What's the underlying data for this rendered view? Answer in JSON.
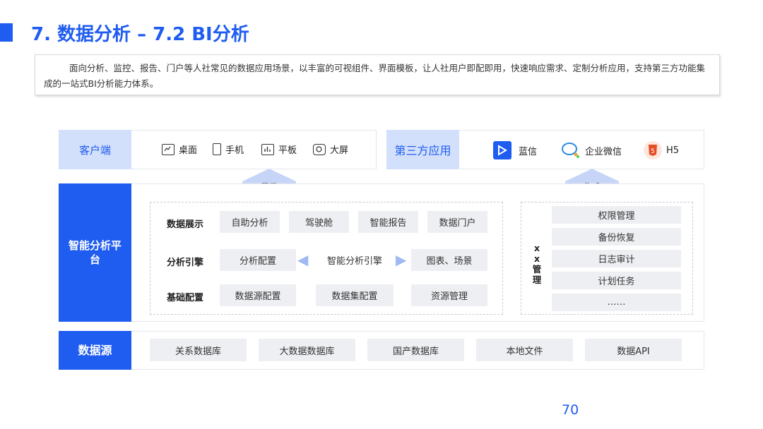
{
  "header": {
    "title": "7. 数据分析 – 7.2 BI分析"
  },
  "description": "面向分析、监控、报告、门户等人社常见的数据应用场景，以丰富的可视组件、界面模板，让人社用户即配即用，快速响应需求、定制分析应用，支持第三方功能集成的一站式BI分析能力体系。",
  "client": {
    "label": "客户端",
    "items": [
      {
        "label": "桌面",
        "icon": "desktop-icon"
      },
      {
        "label": "手机",
        "icon": "mobile-icon"
      },
      {
        "label": "平板",
        "icon": "tablet-icon"
      },
      {
        "label": "大屏",
        "icon": "large-screen-icon"
      }
    ]
  },
  "third_party": {
    "label": "第三方应用",
    "items": [
      {
        "label": "蓝信",
        "icon": "lanxin-icon"
      },
      {
        "label": "企业微信",
        "icon": "wecom-icon"
      },
      {
        "label": "H5",
        "icon": "html5-icon"
      }
    ]
  },
  "arrows": {
    "display": "展示",
    "integrate": "集成"
  },
  "platform": {
    "label": "智能分析平台",
    "rows": [
      {
        "label": "数据展示",
        "cells": [
          "自助分析",
          "驾驶舱",
          "智能报告",
          "数据门户"
        ]
      },
      {
        "label": "分析引擎",
        "cells": [
          "分析配置",
          "智能分析引擎",
          "图表、场景"
        ]
      },
      {
        "label": "基础配置",
        "cells": [
          "数据源配置",
          "数据集配置",
          "资源管理"
        ]
      }
    ],
    "management": {
      "label": "xx管理",
      "items": [
        "权限管理",
        "备份恢复",
        "日志审计",
        "计划任务",
        "……"
      ]
    }
  },
  "datasource": {
    "label": "数据源",
    "items": [
      "关系数据库",
      "大数据数据库",
      "国产数据库",
      "本地文件",
      "数据API"
    ]
  },
  "page_number": "70",
  "colors": {
    "accent": "#1f5cf0",
    "light": "#d3e0fc",
    "cell": "#eeeff2"
  }
}
